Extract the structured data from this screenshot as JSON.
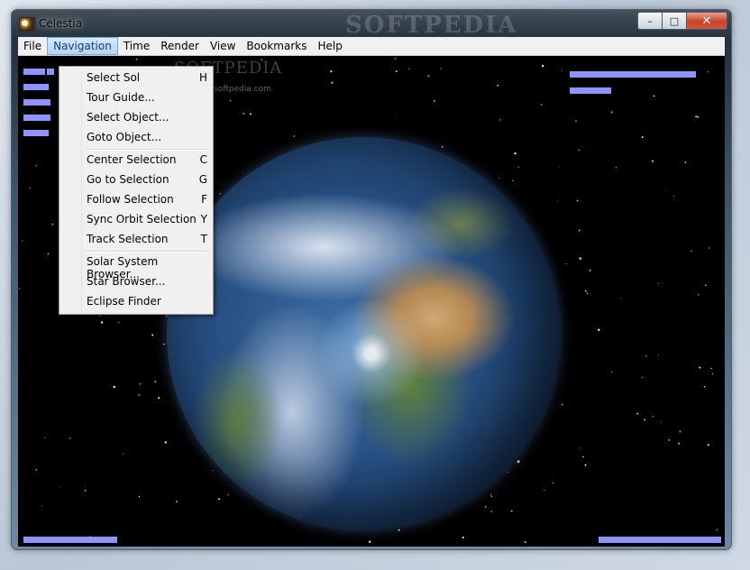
{
  "window": {
    "title": "Celestia",
    "watermark": "SOFTPEDIA",
    "buttons": {
      "minimize": "–",
      "maximize": "□",
      "close": "✕"
    }
  },
  "menubar": {
    "items": [
      "File",
      "Navigation",
      "Time",
      "Render",
      "View",
      "Bookmarks",
      "Help"
    ],
    "active": "Navigation"
  },
  "navigation_menu": {
    "items": [
      {
        "label": "Select Sol",
        "key": "H"
      },
      {
        "label": "Tour Guide...",
        "key": ""
      },
      {
        "label": "Select Object...",
        "key": ""
      },
      {
        "label": "Goto Object...",
        "key": ""
      },
      {
        "label": "Center Selection",
        "key": "C"
      },
      {
        "label": "Go to Selection",
        "key": "G"
      },
      {
        "label": "Follow Selection",
        "key": "F"
      },
      {
        "label": "Sync Orbit Selection",
        "key": "Y"
      },
      {
        "label": "Track Selection",
        "key": "T"
      },
      {
        "label": "Solar System Browser...",
        "key": ""
      },
      {
        "label": "Star Browser...",
        "key": ""
      },
      {
        "label": "Eclipse Finder",
        "key": ""
      }
    ]
  },
  "overlay": {
    "watermark": "SOFTPEDIA",
    "url": "www.softpedia.com"
  },
  "colors": {
    "hud": "#8e93ff",
    "menu_highlight": "#b7d3f3",
    "space": "#000000"
  },
  "icons": [
    "app-icon",
    "minimize-icon",
    "maximize-icon",
    "close-icon"
  ]
}
